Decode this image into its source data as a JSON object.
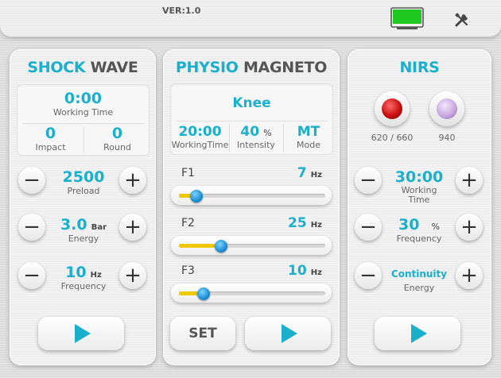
{
  "header": {
    "version": "VER:1.0",
    "battery_color": "#1ec81e"
  },
  "shockwave": {
    "title_a": "SHOCK",
    "title_b": "WAVE",
    "time_value": "0:00",
    "time_label": "Working Time",
    "impact_value": "0",
    "impact_label": "Impact",
    "round_value": "0",
    "round_label": "Round",
    "preload_value": "2500",
    "preload_label": "Preload",
    "energy_value": "3.0",
    "energy_unit": "Bar",
    "energy_label": "Energy",
    "freq_value": "10",
    "freq_unit": "Hz",
    "freq_label": "Frequency",
    "minus": "−",
    "plus": "+"
  },
  "physio": {
    "title_a": "PHYSIO",
    "title_b": "MAGNETO",
    "body_part": "Knee",
    "time_value": "20:00",
    "time_label": "WorkingTime",
    "intensity_value": "40",
    "intensity_unit": "%",
    "intensity_label": "Intensity",
    "mode_value": "MT",
    "mode_label": "Mode",
    "sliders": [
      {
        "label": "F1",
        "value": "7",
        "unit": "Hz",
        "fraction": 0.12
      },
      {
        "label": "F2",
        "value": "25",
        "unit": "Hz",
        "fraction": 0.29
      },
      {
        "label": "F3",
        "value": "10",
        "unit": "Hz",
        "fraction": 0.17
      }
    ],
    "set_label": "SET"
  },
  "nirs": {
    "title": "NIRS",
    "led1_label": "620 / 660",
    "led1_color": "#c81010",
    "led2_label": "940",
    "led2_color": "#c8a8e0",
    "time_value": "30:00",
    "time_label_1": "Working",
    "time_label_2": "Time",
    "freq_value": "30",
    "freq_unit": "%",
    "freq_label": "Frequency",
    "energy_value": "Continuity",
    "energy_label": "Energy",
    "minus": "−",
    "plus": "+"
  }
}
